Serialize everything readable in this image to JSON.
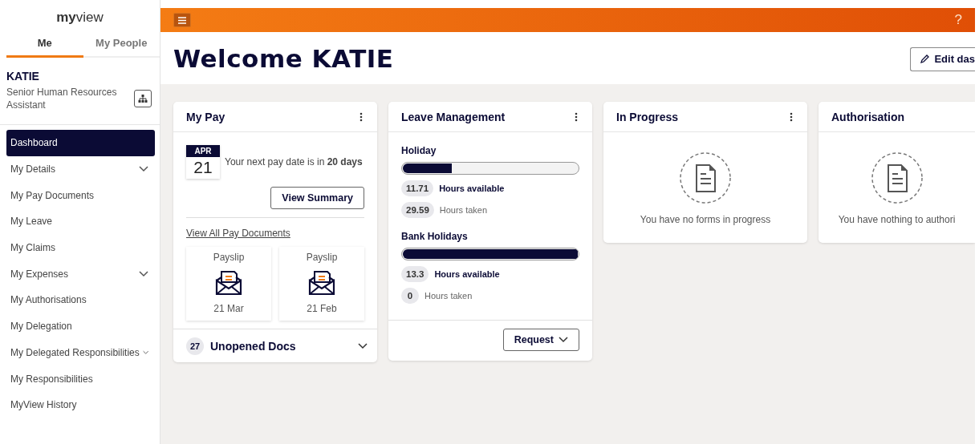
{
  "logo": "**my**view",
  "sidebar": {
    "tabs": [
      {
        "label": "Me",
        "selected": true
      },
      {
        "label": "My People",
        "selected": false
      }
    ],
    "user": {
      "name": "KATIE",
      "role": "Senior Human Resources Assistant"
    },
    "nav": [
      {
        "label": "Dashboard",
        "selected": true,
        "submenu": false
      },
      {
        "label": "My Details",
        "selected": false,
        "submenu": true
      },
      {
        "label": "My Pay Documents",
        "selected": false,
        "submenu": false
      },
      {
        "label": "My Leave",
        "selected": false,
        "submenu": false
      },
      {
        "label": "My Claims",
        "selected": false,
        "submenu": false
      },
      {
        "label": "My Expenses",
        "selected": false,
        "submenu": true
      },
      {
        "label": "My Authorisations",
        "selected": false,
        "submenu": false
      },
      {
        "label": "My Delegation",
        "selected": false,
        "submenu": false
      },
      {
        "label": "My Delegated Responsibilities",
        "selected": false,
        "submenu": true
      },
      {
        "label": "My Responsibilities",
        "selected": false,
        "submenu": false
      },
      {
        "label": "MyView History",
        "selected": false,
        "submenu": false
      }
    ]
  },
  "topbar": {
    "help": "?"
  },
  "header": {
    "title": "Welcome KATIE",
    "edit_button": "Edit das"
  },
  "cards": [
    {
      "kind": "pay",
      "title": "My Pay",
      "menu": true,
      "calendar": {
        "month": "APR",
        "day": "21"
      },
      "message": "Your next pay date is in **20 days**",
      "button": "View Summary",
      "link": "View All Pay Documents",
      "documents": [
        {
          "label": "Payslip",
          "date": "21 Mar"
        },
        {
          "label": "Payslip",
          "date": "21 Feb"
        }
      ],
      "footer": {
        "count": "27",
        "label": "Unopened Docs"
      }
    },
    {
      "kind": "leave",
      "title": "Leave Management",
      "menu": true,
      "balances": [
        {
          "name": "Holiday",
          "level": 0.28,
          "available": "11.71",
          "available_label": "Hours available",
          "taken": "29.59",
          "taken_label": "Hours taken"
        },
        {
          "name": "Bank Holidays",
          "level": 1,
          "available": "13.3",
          "available_label": "Hours available",
          "taken": "0",
          "taken_label": "Hours taken"
        }
      ],
      "button": "Request"
    },
    {
      "kind": "empty",
      "title": "In Progress",
      "menu": true,
      "message": "You have no forms in progress"
    },
    {
      "kind": "empty",
      "title": "Authorisation",
      "menu": false,
      "message": "You have nothing to authori"
    }
  ]
}
